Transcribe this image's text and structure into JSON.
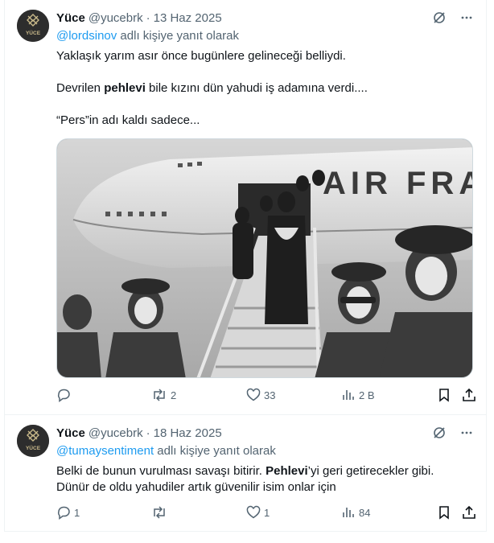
{
  "tweets": [
    {
      "name": "Yüce",
      "handle": "@yucebrk",
      "separator": "·",
      "date": "13 Haz 2025",
      "reply_mention": "@lordsinov",
      "reply_suffix": " adlı kişiye yanıt olarak",
      "paragraphs": [
        {
          "parts": [
            {
              "text": "Yaklaşık yarım asır önce bugünlere gelineceği belliydi.",
              "bold": false
            }
          ]
        },
        {
          "parts": [
            {
              "text": "Devrilen ",
              "bold": false
            },
            {
              "text": "pehlevi",
              "bold": true
            },
            {
              "text": " bile kızını dün yahudi iş adamına verdi....",
              "bold": false
            }
          ]
        },
        {
          "parts": [
            {
              "text": "“Pers”in adı kaldı sadece...",
              "bold": false
            }
          ]
        }
      ],
      "avatar_text": "YÜCE",
      "actions": {
        "replies": "",
        "reposts": "2",
        "likes": "33",
        "views": "2 B"
      }
    },
    {
      "name": "Yüce",
      "handle": "@yucebrk",
      "separator": "·",
      "date": "18 Haz 2025",
      "reply_mention": "@tumaysentiment",
      "reply_suffix": " adlı kişiye yanıt olarak",
      "paragraphs": [
        {
          "parts": [
            {
              "text": "Belki de bunun vurulması savaşı bitirir. ",
              "bold": false
            },
            {
              "text": "Pehlevi",
              "bold": true
            },
            {
              "text": "’yi geri getirecekler gibi.",
              "bold": false
            }
          ]
        },
        {
          "parts": [
            {
              "text": "Dünür de oldu yahudiler artık güvenilir isim onlar için",
              "bold": false
            }
          ]
        }
      ],
      "avatar_text": "YÜCE",
      "actions": {
        "replies": "1",
        "reposts": "",
        "likes": "1",
        "views": "84"
      }
    }
  ],
  "media_painted_text": "AIR FRANCE",
  "colors": {
    "link": "#1d9bf0",
    "muted": "#536471",
    "text": "#0f1419",
    "border": "#eff3f4"
  }
}
